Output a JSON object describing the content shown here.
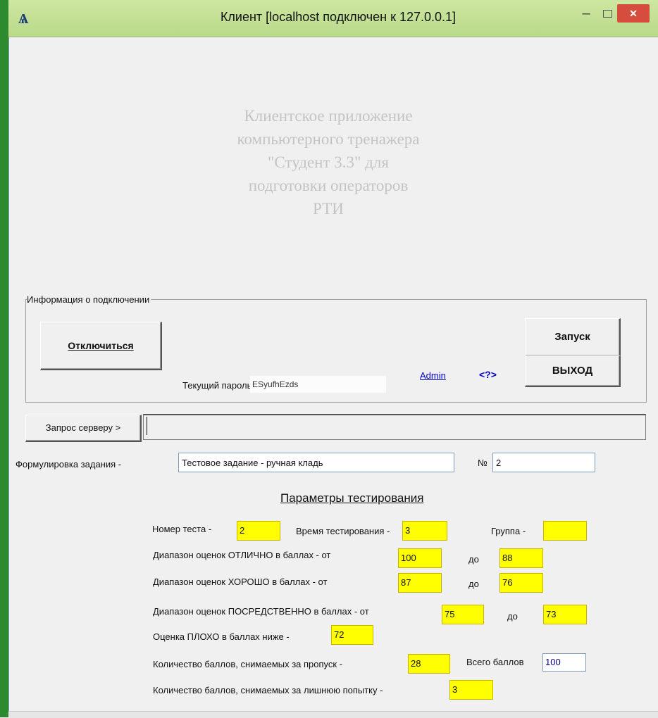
{
  "window": {
    "title": "Клиент [localhost подключен к 127.0.0.1]",
    "icon": "app-logo-icon",
    "close_glyph": "✕",
    "minimize_glyph": "–"
  },
  "banner": {
    "lines": [
      "Клиентское приложение",
      "компьютерного тренажера",
      "\"Студент 3.3\" для",
      "подготовки операторов",
      "РТИ"
    ]
  },
  "connection": {
    "group_label": "Информация о подключении",
    "disconnect_label": "Отключиться",
    "launch_label": "Запуск",
    "exit_label": "ВЫХОД",
    "password_label": "Текущий пароль:",
    "password_value": "ESyufhEzds",
    "admin_link": "Admin",
    "help_link": "<?>"
  },
  "request": {
    "button_label": "Запрос серверу >",
    "value": ""
  },
  "task": {
    "label": "Формулировка задания -",
    "value": "Тестовое задание - ручная кладь",
    "number_label": "№",
    "number_value": "2"
  },
  "params": {
    "heading": "Параметры тестирования",
    "test_number_label": "Номер теста -",
    "test_number_value": "2",
    "time_label": "Время тестирования -",
    "time_value": "3",
    "group_label": "Группа -",
    "group_value": "",
    "excellent_label": "Диапазон оценок ОТЛИЧНО в баллах - от",
    "excellent_from": "100",
    "excellent_to": "88",
    "good_label": "Диапазон оценок ХОРОШО в баллах - от",
    "good_from": "87",
    "good_to": "76",
    "satisfactory_label": "Диапазон оценок ПОСРЕДСТВЕННО в баллах - от",
    "satisfactory_from": "75",
    "satisfactory_to": "73",
    "to_label": "до",
    "poor_label": "Оценка ПЛОХО в баллах ниже -",
    "poor_value": "72",
    "skip_penalty_label": "Количество баллов, снимаемых за пропуск -",
    "skip_penalty_value": "28",
    "total_label": "Всего баллов",
    "total_value": "100",
    "extra_attempt_label": "Количество баллов, снимаемых за лишнюю попытку -",
    "extra_attempt_value": "3"
  },
  "colors": {
    "title_bar": "#c0dd94",
    "close_button": "#d64d3e",
    "highlight_field": "#ffff00",
    "link": "#0000cc",
    "banner_text": "#c4c4c4"
  }
}
